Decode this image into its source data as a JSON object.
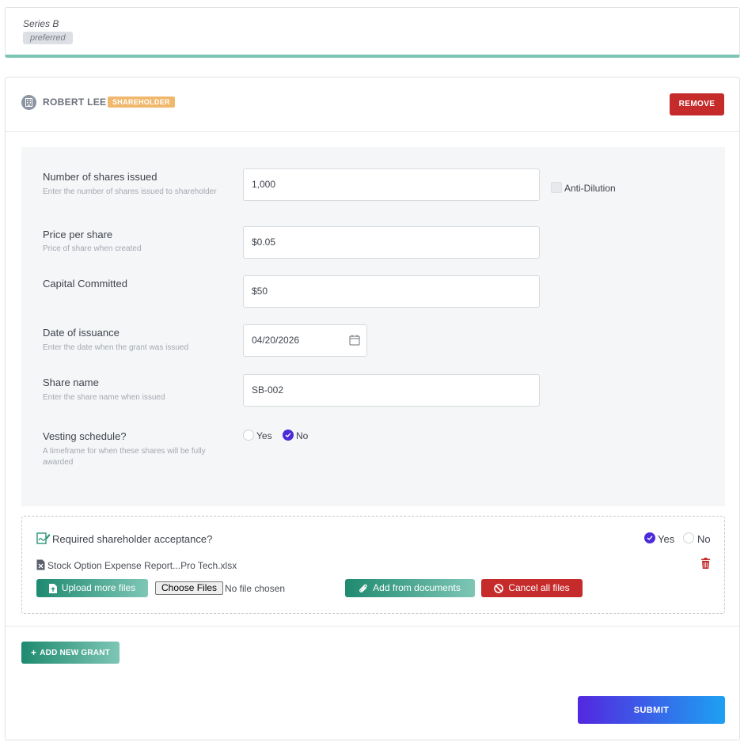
{
  "series": {
    "name": "Series B",
    "badge": "preferred"
  },
  "holder": {
    "name": "ROBERT LEE",
    "role_badge": "SHAREHOLDER",
    "remove_label": "REMOVE"
  },
  "form": {
    "shares_issued": {
      "label": "Number of shares issued",
      "help": "Enter the number of shares issued to shareholder",
      "value": "1,000"
    },
    "anti_dilution": {
      "label": "Anti-Dilution",
      "checked": false
    },
    "price_per_share": {
      "label": "Price per share",
      "help": "Price of share when created",
      "value": "$0.05"
    },
    "capital_committed": {
      "label": "Capital Committed",
      "value": "$50"
    },
    "date_of_issuance": {
      "label": "Date of issuance",
      "help": "Enter the date when the grant was issued",
      "value": "04/20/2026"
    },
    "share_name": {
      "label": "Share name",
      "help": "Enter the share name when issued",
      "value": "SB-002"
    },
    "vesting": {
      "label": "Vesting schedule?",
      "help": "A timeframe for when these shares will be fully awarded",
      "yes_label": "Yes",
      "no_label": "No",
      "selected": "No"
    }
  },
  "acceptance": {
    "label": "Required shareholder acceptance?",
    "yes_label": "Yes",
    "no_label": "No",
    "selected": "Yes",
    "file_name": "Stock Option Expense Report...Pro Tech.xlsx",
    "upload_more_label": "Upload more files",
    "choose_files_label": "Choose Files",
    "no_file_text": "No file chosen",
    "add_from_documents_label": "Add from documents",
    "cancel_all_label": "Cancel all files"
  },
  "actions": {
    "add_grant_label": "ADD NEW GRANT",
    "submit_label": "SUBMIT"
  },
  "colors": {
    "accent_teal": "#1e8a6f",
    "danger_red": "#c62b2b",
    "radio_purple": "#4b2ad8",
    "badge_orange": "#f0b86c",
    "submit_gradient_start": "#5327e0",
    "submit_gradient_end": "#1da1f2"
  }
}
